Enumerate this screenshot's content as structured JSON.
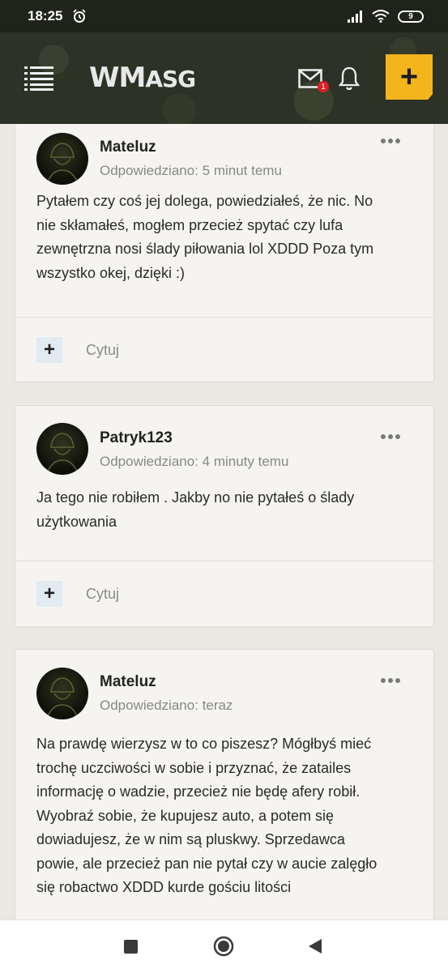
{
  "status": {
    "time": "18:25",
    "battery": "9"
  },
  "header": {
    "logo_main": "WM",
    "logo_small": "ASG",
    "mail_badge": "1",
    "add_label": "+"
  },
  "posts": [
    {
      "author": "Mateluz",
      "meta": "Odpowiedziano: 5 minut temu",
      "lines": [
        "Pytałem czy coś jej dolega, powiedziałeś, że nic. No",
        "nie skłamałeś, mogłem przecież spytać czy lufa",
        "zewnętrzna nosi ślady piłowania lol XDDD Poza tym",
        "wszystko okej, dzięki :)"
      ],
      "plus_label": "+",
      "quote_label": "Cytuj"
    },
    {
      "author": "Patryk123",
      "meta": "Odpowiedziano: 4 minuty temu",
      "lines": [
        "Ja tego nie robiłem . Jakby no nie pytałeś o ślady",
        "użytkowania"
      ],
      "plus_label": "+",
      "quote_label": "Cytuj"
    },
    {
      "author": "Mateluz",
      "meta": "Odpowiedziano: teraz",
      "lines": [
        "Na prawdę wierzysz w to co piszesz? Mógłbyś mieć",
        "trochę uczciwości w sobie i przyznać, że zatailes",
        "informację o wadzie, przecież nie będę afery robił.",
        "Wyobraź sobie, że kupujesz auto, a potem się",
        "dowiadujesz, że w nim są pluskwy. Sprzedawca",
        "powie, ale przecież pan nie pytał czy w aucie zalęgło",
        "się robactwo XDDD kurde gościu litości"
      ]
    }
  ],
  "colors": {
    "accent": "#f3b41c",
    "header_bg": "#2c3225",
    "badge": "#e11d24"
  }
}
